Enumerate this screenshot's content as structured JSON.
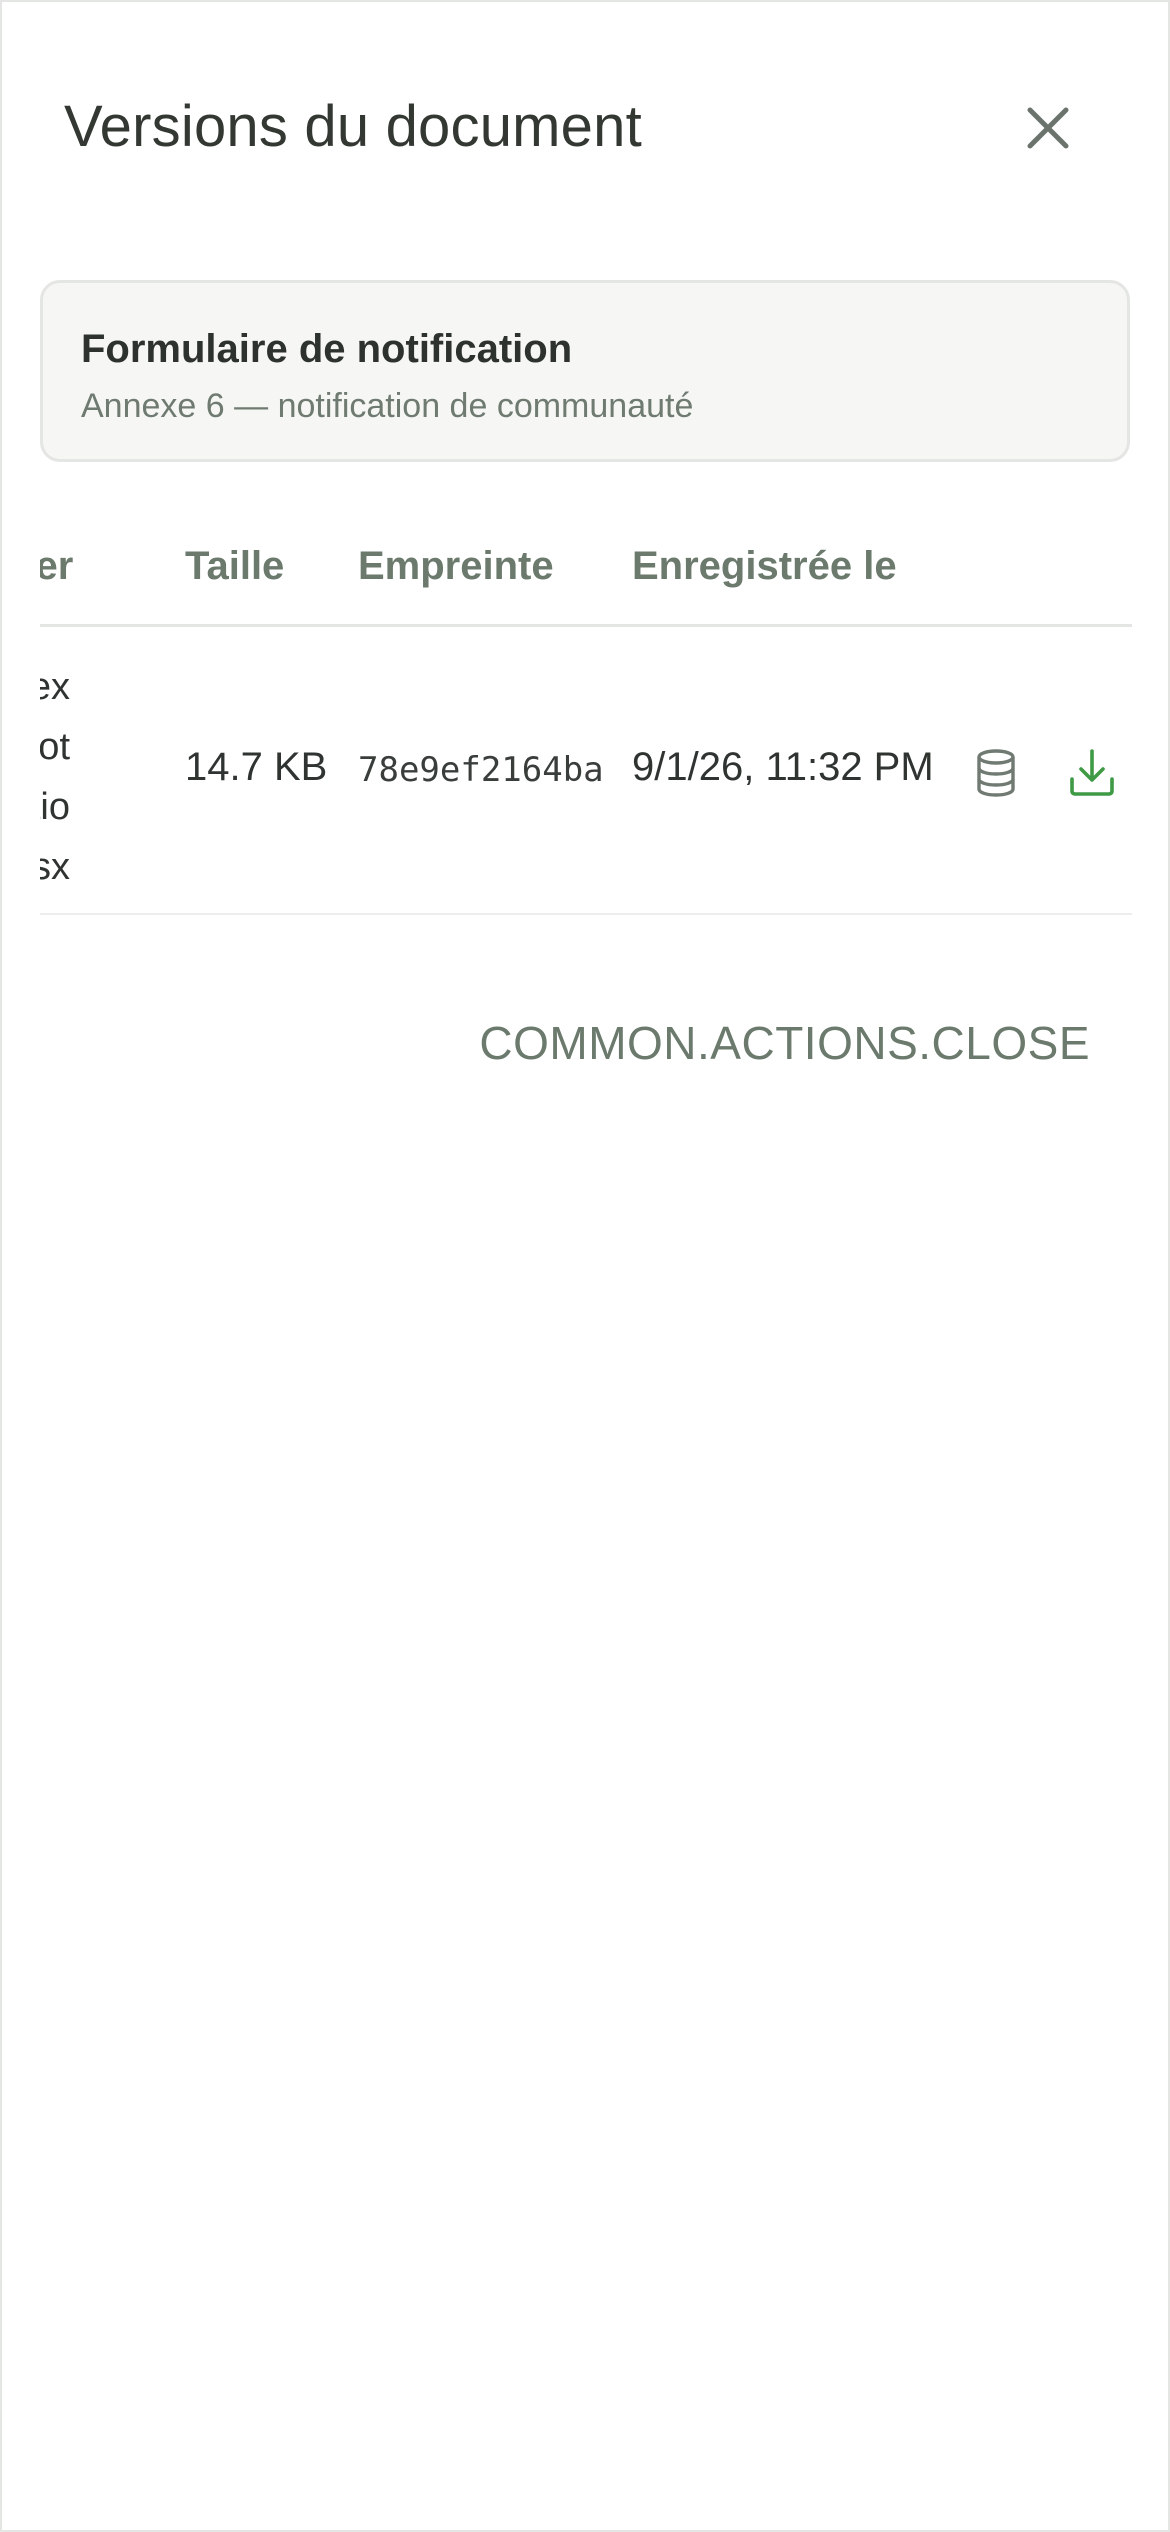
{
  "dialog": {
    "title": "Versions du document",
    "close_icon": "close-icon"
  },
  "document": {
    "name": "Formulaire de notification",
    "description": "Annexe 6 — notification de communauté"
  },
  "table": {
    "columns": [
      "hier",
      "Taille",
      "Empreinte",
      "Enregistrée le"
    ],
    "rows": [
      {
        "file_lines": [
          "nex",
          "-not",
          "atio",
          "lsx"
        ],
        "size": "14.7 KB",
        "hash": "78e9ef2164ba",
        "saved_on": "9/1/26, 11:32 PM",
        "icons": [
          "database-icon",
          "download-icon"
        ]
      }
    ]
  },
  "footer": {
    "close_label": "COMMON.ACTIONS.CLOSE"
  },
  "colors": {
    "accent_green": "#3f9a45",
    "muted_green_gray": "#6b7a6d"
  }
}
